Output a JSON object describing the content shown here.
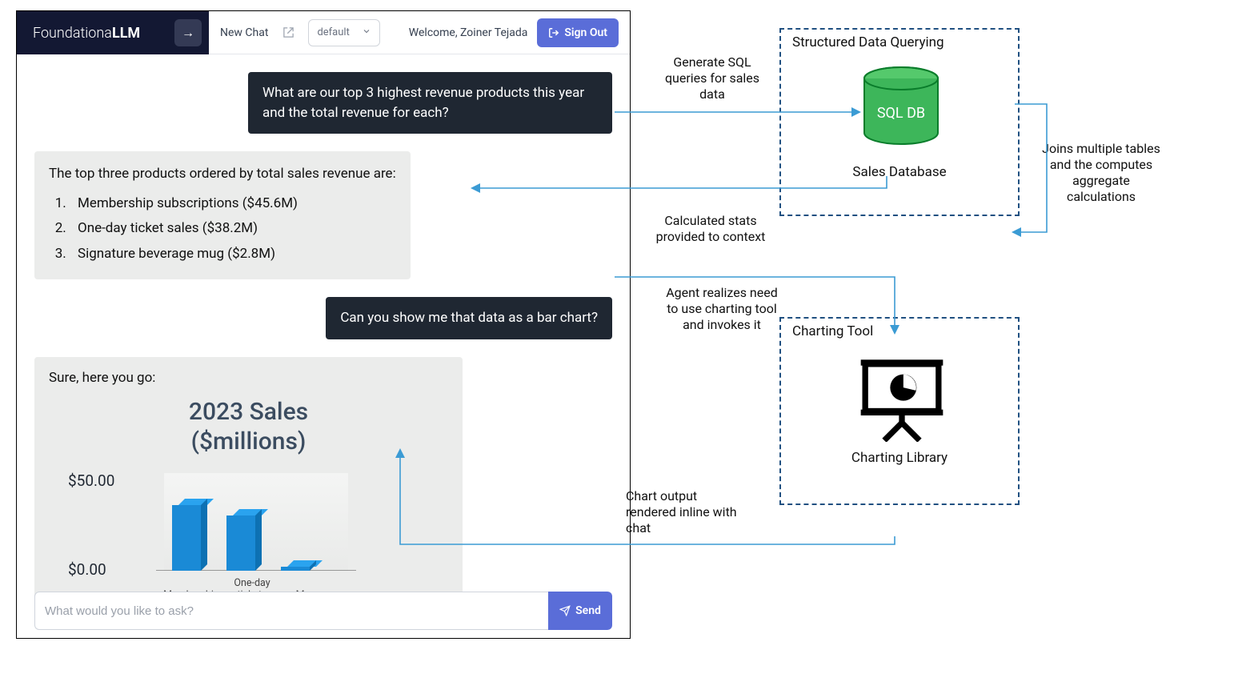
{
  "app": {
    "logo_prefix": "Foundationa",
    "logo_bold": "LLM",
    "new_chat": "New Chat",
    "agent_select": "default",
    "welcome": "Welcome, Zoiner Tejada",
    "sign_out": "Sign Out",
    "input_placeholder": "What would you like to ask?",
    "send": "Send"
  },
  "chat": {
    "u1": "What are our top 3 highest revenue products this year and the total revenue for each?",
    "a1_intro": "The top three products ordered by total sales revenue are:",
    "a1_items": [
      "Membership subscriptions ($45.6M)",
      "One-day ticket sales ($38.2M)",
      "Signature beverage mug ($2.8M)"
    ],
    "u2": "Can you show me that data as a bar chart?",
    "a2_intro": "Sure, here you go:"
  },
  "chart_data": {
    "type": "bar",
    "title": "2023 Sales ($millions)",
    "categories": [
      "Membership",
      "One-day tickets",
      "Mug"
    ],
    "values": [
      45.6,
      38.2,
      2.8
    ],
    "ylabel": "",
    "yticks": [
      "$50.00",
      "$0.00"
    ],
    "ylim": [
      0,
      50
    ]
  },
  "diagram": {
    "box1_title": "Structured Data Querying",
    "db_label": "SQL DB",
    "db_caption": "Sales Database",
    "box2_title": "Charting Tool",
    "chart_caption": "Charting Library",
    "ann_generate": "Generate SQL queries for sales data",
    "ann_joins": "Joins multiple tables and the computes aggregate calculations",
    "ann_context": "Calculated stats provided to context",
    "ann_agent": "Agent realizes need to use charting tool and invokes it",
    "ann_rendered": "Chart output rendered inline with chat"
  }
}
